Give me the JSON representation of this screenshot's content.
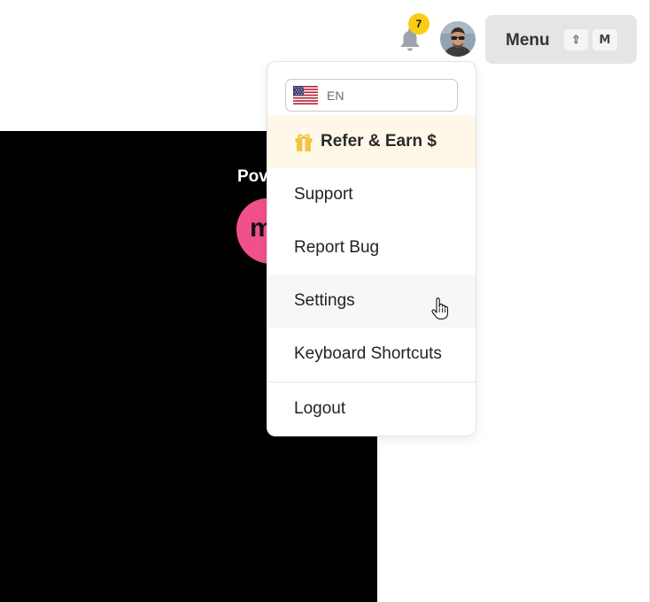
{
  "background": {
    "powered_text": "Pov",
    "brand_letter": "m"
  },
  "header": {
    "notifications": {
      "icon": "bell-icon",
      "count": "7",
      "badge_color": "#facc15"
    },
    "avatar": {
      "icon": "user-avatar"
    },
    "menu_button": {
      "label": "Menu",
      "shortcut_keys": [
        "⇧",
        "M"
      ]
    }
  },
  "dropdown": {
    "language": {
      "flag_icon": "us-flag-icon",
      "code": "EN"
    },
    "items": [
      {
        "label": "Refer & Earn $",
        "icon": "gift-icon",
        "highlight_color": "#fff8e8"
      },
      {
        "label": "Support"
      },
      {
        "label": "Report Bug"
      },
      {
        "label": "Settings",
        "hovered": true
      },
      {
        "label": "Keyboard Shortcuts"
      },
      {
        "label": "Logout"
      }
    ]
  },
  "colors": {
    "accent": "#f6c343",
    "brand_pink": "#f0508c"
  }
}
